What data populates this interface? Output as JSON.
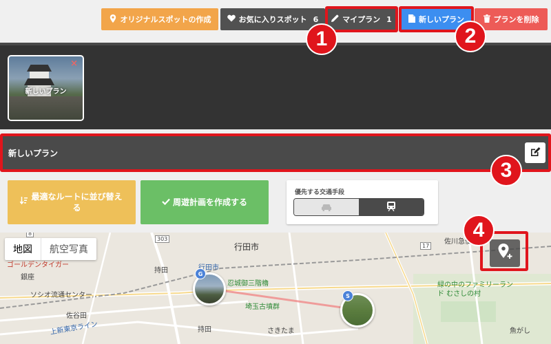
{
  "toolbar": {
    "original_spot_label": "オリジナルスポットの作成",
    "favorites_label": "お気に入りスポット",
    "favorites_count": "6",
    "my_plan_label": "マイプラン",
    "my_plan_count": "1",
    "new_plan_label": "新しいプラン",
    "delete_plan_label": "プランを削除"
  },
  "markers": [
    "1",
    "2",
    "3",
    "4"
  ],
  "plan_strip": {
    "thumbnail_label": "新しいプラン",
    "remove_symbol": "×"
  },
  "plan": {
    "title": "新しいプラン"
  },
  "actions": {
    "sort_label": "最適なルートに並び替える",
    "tour_label": "周遊計画を作成する"
  },
  "transport": {
    "label": "優先する交通手段",
    "options": [
      "car",
      "train"
    ],
    "selected": "train"
  },
  "map": {
    "type_map": "地図",
    "type_satellite": "航空写真",
    "labels": {
      "gyoda_city": "行田市",
      "gyoda_station": "行田市",
      "castle": "忍城御三階櫓",
      "sakitama": "埼玉古墳群",
      "sakitama2": "さきたま",
      "mochida": "持田",
      "mochida_st": "持田",
      "sasai": "佐谷田",
      "ginza": "銀座",
      "soshio": "ソシオ流通センター",
      "kumagaya_line": "上新東京ライン",
      "golf": "ゴールデンタイガー",
      "sakawa": "佐川急便",
      "family_land": "緑の中のファミリーランド むさしの村",
      "uogashi": "魚がし",
      "route_303": "303",
      "route_8": "8",
      "route_17": "17"
    },
    "spots": [
      {
        "letter": "G",
        "name": "忍城御三階櫓"
      },
      {
        "letter": "S",
        "name": "埼玉古墳群"
      }
    ],
    "route_color": "#f08a8a"
  },
  "colors": {
    "highlight": "#e0151c",
    "orange": "#f2a54a",
    "dark": "#515151",
    "blue": "#3c8ef0",
    "red": "#ed5b57",
    "yellow": "#eec059",
    "green": "#6bbf66"
  }
}
